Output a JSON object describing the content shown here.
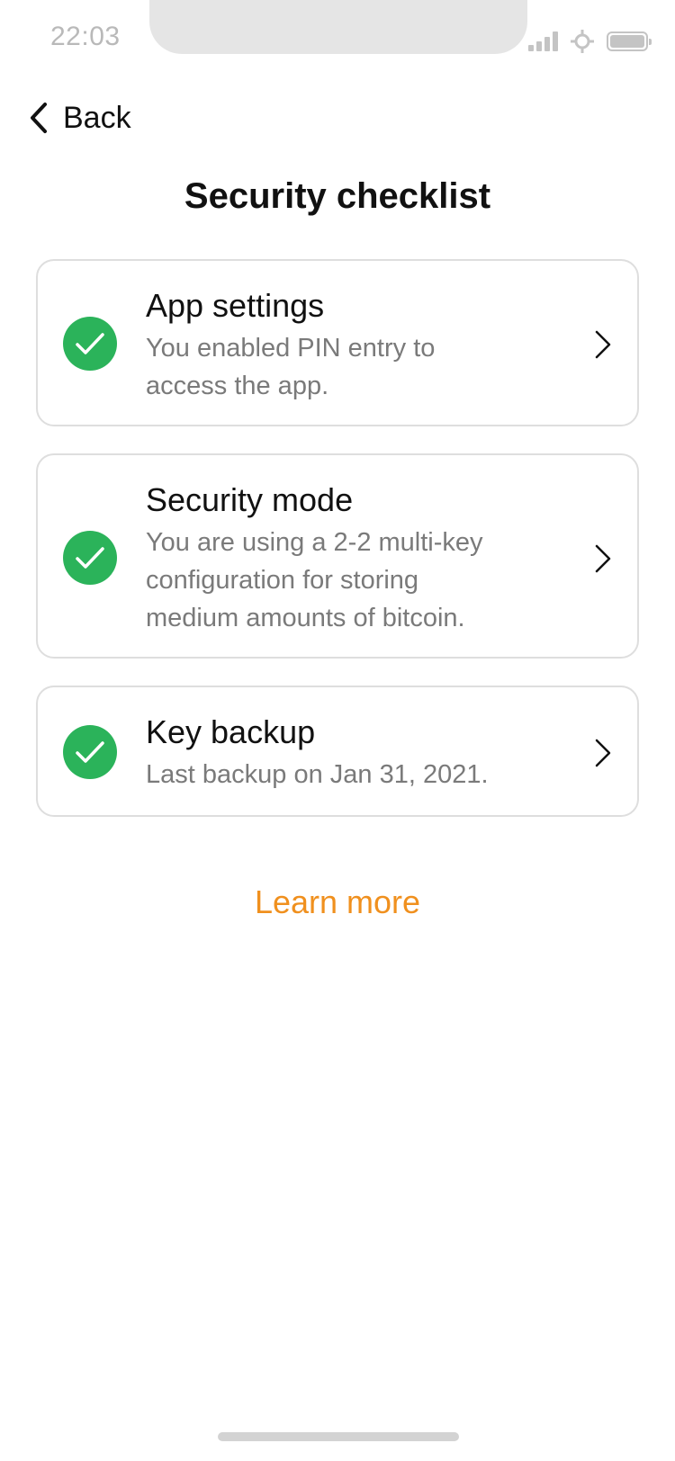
{
  "status_bar": {
    "time": "22:03"
  },
  "nav": {
    "back_label": "Back"
  },
  "page": {
    "title": "Security checklist"
  },
  "checklist": [
    {
      "title": "App settings",
      "description_lines": [
        "You enabled PIN entry to",
        "access the app."
      ],
      "status": "complete"
    },
    {
      "title": "Security mode",
      "description_lines": [
        "You are using a 2-2 multi-key",
        "configuration for storing",
        "medium amounts of bitcoin."
      ],
      "status": "complete"
    },
    {
      "title": "Key backup",
      "description_lines": [
        "Last backup on Jan 31, 2021."
      ],
      "status": "complete"
    }
  ],
  "footer": {
    "learn_more": "Learn more"
  },
  "colors": {
    "success": "#2bb35a",
    "accent": "#f0901e"
  },
  "icons": {
    "back": "chevron-left-icon",
    "check": "check-icon",
    "row": "chevron-right-icon"
  }
}
